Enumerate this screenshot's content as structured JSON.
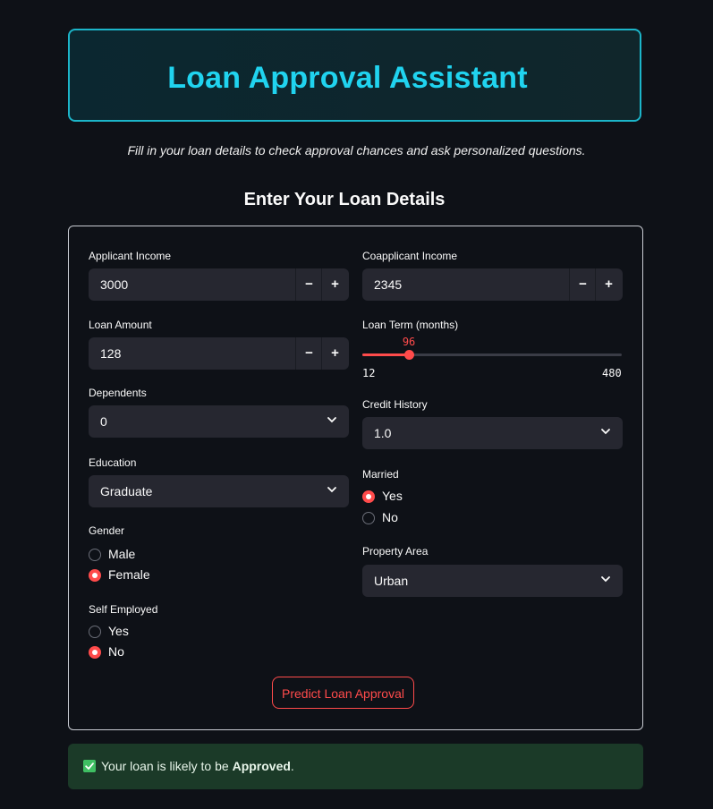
{
  "header": {
    "title": "Loan Approval Assistant"
  },
  "subtitle": "Fill in your loan details to check approval chances and ask personalized questions.",
  "section_title": "Enter Your Loan Details",
  "form": {
    "applicant_income": {
      "label": "Applicant Income",
      "value": "3000"
    },
    "coapplicant_income": {
      "label": "Coapplicant Income",
      "value": "2345"
    },
    "loan_amount": {
      "label": "Loan Amount",
      "value": "128"
    },
    "loan_term": {
      "label": "Loan Term (months)",
      "value": "96",
      "min": "12",
      "max": "480",
      "fraction": 0.1795
    },
    "dependents": {
      "label": "Dependents",
      "value": "0"
    },
    "credit_history": {
      "label": "Credit History",
      "value": "1.0"
    },
    "education": {
      "label": "Education",
      "value": "Graduate"
    },
    "married": {
      "label": "Married",
      "options": [
        "Yes",
        "No"
      ],
      "selected": "Yes"
    },
    "gender": {
      "label": "Gender",
      "options": [
        "Male",
        "Female"
      ],
      "selected": "Female"
    },
    "property_area": {
      "label": "Property Area",
      "value": "Urban"
    },
    "self_employed": {
      "label": "Self Employed",
      "options": [
        "Yes",
        "No"
      ],
      "selected": "No"
    },
    "minus": "−",
    "plus": "+"
  },
  "predict_button": "Predict Loan Approval",
  "result": {
    "prefix": "Your loan is likely to be ",
    "status": "Approved",
    "suffix": "."
  },
  "colors": {
    "accent": "#ff4b4b",
    "title": "#20d3ef",
    "success_bg": "#1b3a28"
  }
}
